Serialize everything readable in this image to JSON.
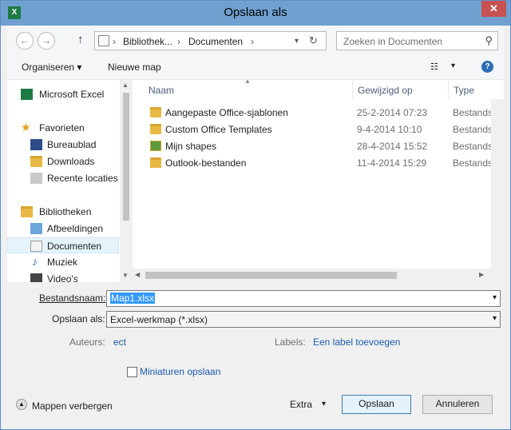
{
  "window": {
    "title": "Opslaan als",
    "app_icon": "X",
    "close_label": "✕"
  },
  "nav": {
    "back": "←",
    "forward": "→",
    "up": "↑",
    "breadcrumb": [
      "Bibliothek...",
      "Documenten"
    ],
    "search_placeholder": "Zoeken in Documenten"
  },
  "toolbar": {
    "organize": "Organiseren ▾",
    "new_folder": "Nieuwe map",
    "help": "?"
  },
  "sidebar": {
    "app": "Microsoft Excel",
    "favorites": "Favorieten",
    "fav_items": [
      "Bureaublad",
      "Downloads",
      "Recente locaties"
    ],
    "libraries": "Bibliotheken",
    "lib_items": [
      "Afbeeldingen",
      "Documenten",
      "Muziek",
      "Video's"
    ]
  },
  "columns": {
    "name": "Naam",
    "modified": "Gewijzigd op",
    "type": "Type"
  },
  "files": [
    {
      "name": "Aangepaste Office-sjablonen",
      "date": "25-2-2014 07:23",
      "type": "Bestandsmap"
    },
    {
      "name": "Custom Office Templates",
      "date": "9-4-2014 10:10",
      "type": "Bestandsmap"
    },
    {
      "name": "Mijn shapes",
      "date": "28-4-2014 15:52",
      "type": "Bestandsmap"
    },
    {
      "name": "Outlook-bestanden",
      "date": "11-4-2014 15:29",
      "type": "Bestandsmap"
    }
  ],
  "form": {
    "filename_label": "Bestandsnaam:",
    "filename_value": "Map1.xlsx",
    "savetype_label": "Opslaan als:",
    "savetype_value": "Excel-werkmap (*.xlsx)",
    "authors_label": "Auteurs:",
    "authors_value": "ect",
    "labels_label": "Labels:",
    "labels_value": "Een label toevoegen",
    "thumbnails_label": "Miniaturen opslaan"
  },
  "footer": {
    "hide_folders": "Mappen verbergen",
    "extra": "Extra",
    "save": "Opslaan",
    "cancel": "Annuleren"
  }
}
